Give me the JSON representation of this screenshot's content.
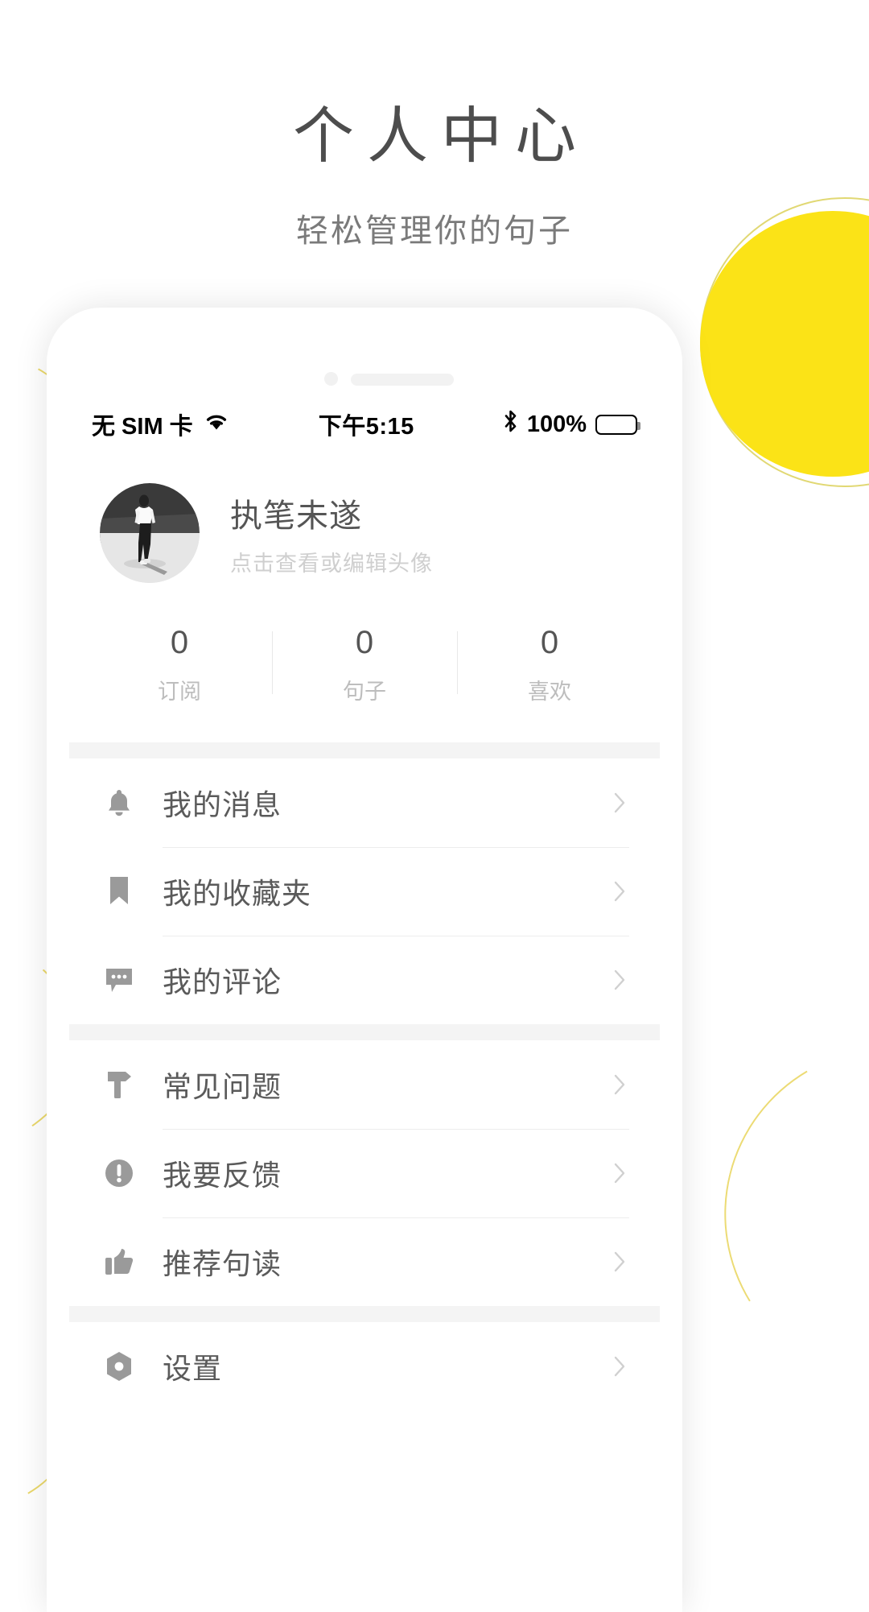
{
  "header": {
    "title": "个人中心",
    "subtitle": "轻松管理你的句子"
  },
  "colors": {
    "accent_yellow": "#FBE317",
    "arc_yellow": "#E4CC3A",
    "text_dark": "#4d4d4d",
    "text_muted": "#bdbdbd",
    "icon_gray": "#9a9a9a"
  },
  "phone": {
    "status_bar": {
      "carrier": "无 SIM 卡",
      "wifi_icon": "wifi-icon",
      "time": "下午5:15",
      "bluetooth_icon": "bluetooth-icon",
      "battery_percent": "100%",
      "battery_icon": "battery-full-icon"
    },
    "profile": {
      "avatar_icon": "user-avatar-photo",
      "name": "执笔未遂",
      "hint": "点击查看或编辑头像"
    },
    "stats": [
      {
        "value": "0",
        "label": "订阅"
      },
      {
        "value": "0",
        "label": "句子"
      },
      {
        "value": "0",
        "label": "喜欢"
      }
    ],
    "menu_groups": [
      {
        "items": [
          {
            "icon": "bell-icon",
            "label": "我的消息",
            "chevron": "chevron-right-icon"
          },
          {
            "icon": "bookmark-icon",
            "label": "我的收藏夹",
            "chevron": "chevron-right-icon"
          },
          {
            "icon": "comment-icon",
            "label": "我的评论",
            "chevron": "chevron-right-icon"
          }
        ]
      },
      {
        "items": [
          {
            "icon": "signpost-icon",
            "label": "常见问题",
            "chevron": "chevron-right-icon"
          },
          {
            "icon": "alert-icon",
            "label": "我要反馈",
            "chevron": "chevron-right-icon"
          },
          {
            "icon": "thumbs-up-icon",
            "label": "推荐句读",
            "chevron": "chevron-right-icon"
          }
        ]
      },
      {
        "items": [
          {
            "icon": "gear-icon",
            "label": "设置",
            "chevron": "chevron-right-icon"
          }
        ]
      }
    ]
  }
}
